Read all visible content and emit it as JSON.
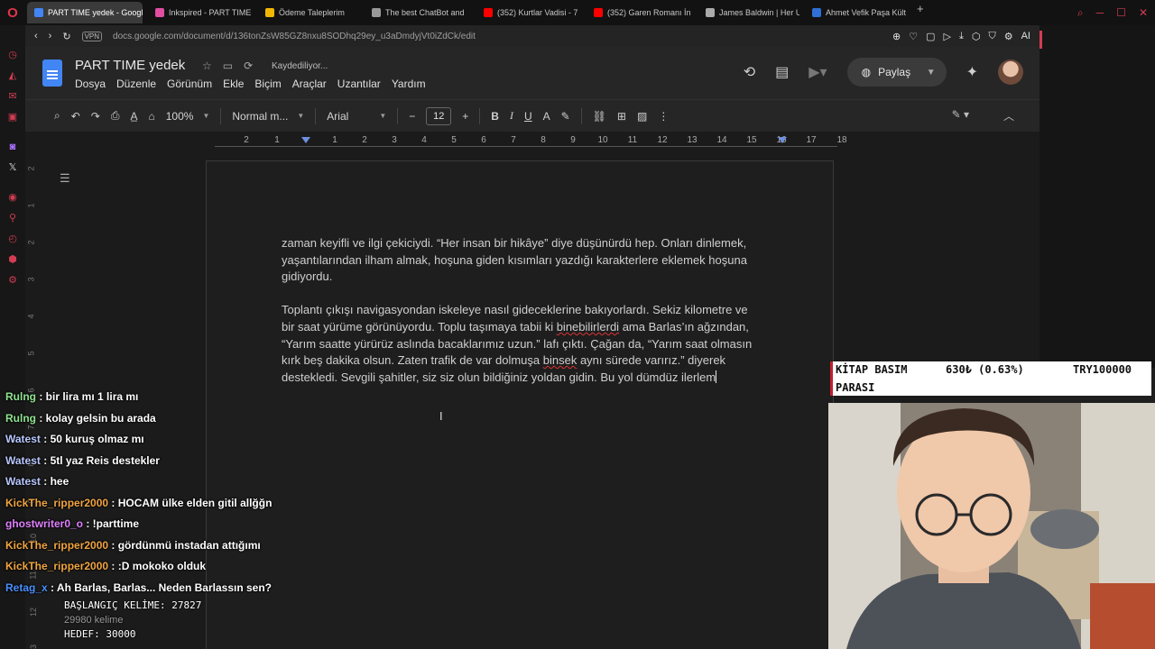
{
  "browser": {
    "tabs": [
      {
        "title": "PART TIME yedek - Google",
        "color": "#4285f4",
        "active": true
      },
      {
        "title": "Inkspired - PART TIME",
        "color": "#e04ea2",
        "active": false
      },
      {
        "title": "Ödeme Taleplerim",
        "color": "#f2b705",
        "active": false
      },
      {
        "title": "The best ChatBot and",
        "color": "#999999",
        "active": false
      },
      {
        "title": "(352) Kurtlar Vadisi - 7",
        "color": "#ff0000",
        "active": false
      },
      {
        "title": "(352) Garen Romanı İn",
        "color": "#ff0000",
        "active": false
      },
      {
        "title": "James Baldwin | Her U",
        "color": "#aaaaaa",
        "active": false
      },
      {
        "title": "Ahmet Vefik Paşa Kültü",
        "color": "#2f6fd6",
        "active": false
      }
    ],
    "new_tab": "+",
    "url": "docs.google.com/document/d/136tonZsW85GZ8nxu8SODhq29ey_u3aDmdyjVt0iZdCk/edit",
    "vpn_label": "VPN",
    "ai_label": "AI"
  },
  "docs": {
    "title": "PART TIME yedek",
    "saving_status": "Kaydediliyor...",
    "menu": [
      "Dosya",
      "Düzenle",
      "Görünüm",
      "Ekle",
      "Biçim",
      "Araçlar",
      "Uzantılar",
      "Yardım"
    ],
    "share_label": "Paylaş",
    "toolbar": {
      "zoom": "100%",
      "style": "Normal m...",
      "font": "Arial",
      "font_size": "12"
    },
    "ruler_ticks": [
      "2",
      "1",
      "1",
      "2",
      "3",
      "4",
      "5",
      "6",
      "7",
      "8",
      "9",
      "10",
      "11",
      "12",
      "13",
      "14",
      "15",
      "16",
      "17",
      "18"
    ],
    "vertical_ruler": [
      "2",
      "1",
      "2",
      "3",
      "4",
      "5",
      "6",
      "7",
      "8",
      "9",
      "10",
      "11",
      "12",
      "13"
    ]
  },
  "document": {
    "paragraph1": "zaman keyifli ve ilgi çekiciydi. “Her insan bir hikâye” diye düşünürdü hep. Onları dinlemek, yaşantılarından ilham almak, hoşuna giden kısımları yazdığı karakterlere eklemek hoşuna gidiyordu.",
    "p2_a": "Toplantı çıkışı navigasyondan iskeleye nasıl gideceklerine bakıyorlardı. Sekiz kilometre ve bir saat yürüme görünüyordu. Toplu taşımaya tabii ki ",
    "p2_misspelled1": "binebilirlerdi",
    "p2_b": " ama Barlas’ın ağzından, “Yarım saatte yürürüz aslında bacaklarımız uzun.” lafı çıktı. Çağan da, “Yarım saat olmasın kırk beş dakika olsun. Zaten trafik de var dolmuşa ",
    "p2_misspelled2": "binsek",
    "p2_c": " aynı sürede varırız.” diyerek destekledi. Sevgili şahitler, siz siz olun bildiğiniz yoldan gidin. Bu yol dümdüz ilerlem"
  },
  "ticker": {
    "label_line1": "KİTAP BASIM",
    "label_line2": "PARASI",
    "amount": "630₺ (0.63%)",
    "goal": "TRY100000"
  },
  "chat": [
    {
      "user": "Rulng",
      "color": "#8fe38f",
      "message": " : bir lira mı 1 lira mı"
    },
    {
      "user": "Rulng",
      "color": "#8fe38f",
      "message": " : kolay gelsin bu arada"
    },
    {
      "user": "Watest",
      "color": "#b9c8ff",
      "message": " : 50 kuruş olmaz mı"
    },
    {
      "user": "Watest",
      "color": "#b9c8ff",
      "message": " : 5tl yaz Reis destekler"
    },
    {
      "user": "Watest",
      "color": "#b9c8ff",
      "message": " : hee"
    },
    {
      "user": "KickThe_ripper2000",
      "color": "#f2a541",
      "message": " : HOCAM ülke elden gitil allğğn"
    },
    {
      "user": "ghostwriter0_o",
      "color": "#e080ff",
      "message": " : !parttime"
    },
    {
      "user": "KickThe_ripper2000",
      "color": "#f2a541",
      "message": " : gördünmü instadan attığımı"
    },
    {
      "user": "KickThe_ripper2000",
      "color": "#f2a541",
      "message": " : :D mokoko olduk"
    },
    {
      "user": "Retag_x",
      "color": "#4a90ff",
      "message": " : Ah Barlas, Barlas... Neden Barlassın sen?"
    }
  ],
  "stats": {
    "start_words": "BAŞLANGIÇ KELİME: 27827",
    "word_count": "29980 kelime",
    "target": "HEDEF: 30000"
  }
}
